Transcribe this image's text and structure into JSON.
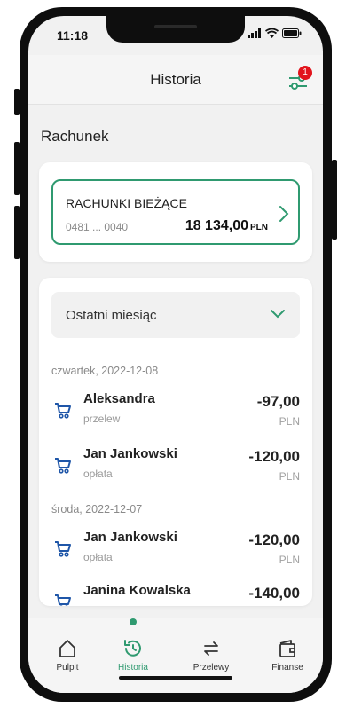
{
  "status_bar": {
    "time": "11:18"
  },
  "header": {
    "title": "Historia",
    "filter_badge": "1"
  },
  "section": {
    "title": "Rachunek"
  },
  "account": {
    "name": "RACHUNKI BIEŻĄCE",
    "number": "0481 ... 0040",
    "balance": "18 134,00",
    "currency": "PLN"
  },
  "history": {
    "period": "Ostatni miesiąc",
    "groups": [
      {
        "date": "czwartek, 2022-12-08",
        "transactions": [
          {
            "name": "Aleksandra",
            "type": "przelew",
            "amount": "-97,00",
            "currency": "PLN"
          },
          {
            "name": "Jan Jankowski",
            "type": "opłata",
            "amount": "-120,00",
            "currency": "PLN"
          }
        ]
      },
      {
        "date": "środa, 2022-12-07",
        "transactions": [
          {
            "name": "Jan Jankowski",
            "type": "opłata",
            "amount": "-120,00",
            "currency": "PLN"
          },
          {
            "name": "Janina Kowalska",
            "type": "",
            "amount": "-140,00",
            "currency": "PLN"
          }
        ]
      }
    ]
  },
  "nav": [
    {
      "label": "Pulpit",
      "icon": "home-icon"
    },
    {
      "label": "Historia",
      "icon": "history-icon",
      "active": true
    },
    {
      "label": "Przelewy",
      "icon": "transfer-icon"
    },
    {
      "label": "Finanse",
      "icon": "wallet-icon"
    }
  ],
  "colors": {
    "accent": "#2f9a70",
    "badge": "#e2141c",
    "icon_blue": "#1f56a8"
  }
}
